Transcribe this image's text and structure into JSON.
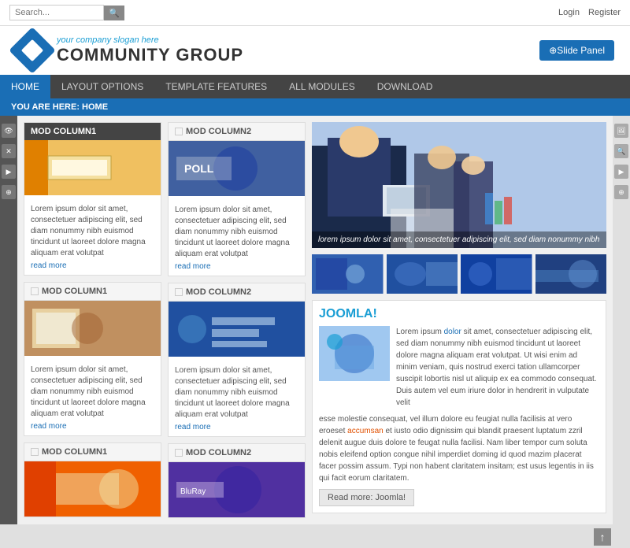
{
  "topBar": {
    "searchPlaceholder": "Search...",
    "searchBtnLabel": "🔍",
    "loginLabel": "Login",
    "registerLabel": "Register"
  },
  "header": {
    "slogan": "your company slogan here",
    "title": "COMMUNITY GROUP",
    "slidePanelLabel": "⊕Slide Panel"
  },
  "nav": {
    "items": [
      {
        "label": "HOME",
        "active": true
      },
      {
        "label": "LAYOUT OPTIONS",
        "active": false
      },
      {
        "label": "TEMPLATE FEATURES",
        "active": false
      },
      {
        "label": "ALL MODULES",
        "active": false
      },
      {
        "label": "DOWNLOAD",
        "active": false
      }
    ]
  },
  "breadcrumb": "YOU ARE HERE: HOME",
  "leftSidebar": {
    "icons": [
      "👁",
      "✕",
      "▶",
      "⊕"
    ]
  },
  "rightSidebar": {
    "icons": [
      "🖼",
      "🔍",
      "▶",
      "⊕"
    ]
  },
  "columns": {
    "col1": {
      "modules": [
        {
          "header": "MOD COLUMN1",
          "headerStyle": "dark",
          "text": "Lorem ipsum dolor sit amet, consectetuer adipiscing elit, sed diam nonummy nibh euismod tincidunt ut laoreet dolore magna aliquam erat volutpat",
          "readMore": "read more"
        },
        {
          "header": "MOD COLUMN1",
          "headerStyle": "light",
          "text": "Lorem ipsum dolor sit amet, consectetuer adipiscing elit, sed diam nonummy nibh euismod tincidunt ut laoreet dolore magna aliquam erat volutpat",
          "readMore": "read more"
        },
        {
          "header": "MOD COLUMN1",
          "headerStyle": "light",
          "text": "",
          "readMore": ""
        }
      ]
    },
    "col2": {
      "modules": [
        {
          "header": "MOD COLUMN2",
          "headerStyle": "light",
          "text": "Lorem ipsum dolor sit amet, consectetuer adipiscing elit, sed diam nonummy nibh euismod tincidunt ut laoreet dolore magna aliquam erat volutpat",
          "readMore": "read more"
        },
        {
          "header": "MOD COLUMN2",
          "headerStyle": "light",
          "text": "Lorem ipsum dolor sit amet, consectetuer adipiscing elit, sed diam nonummy nibh euismod tincidunt ut laoreet dolore magna aliquam erat volutpat",
          "readMore": "read more"
        },
        {
          "header": "MOD COLUMN2",
          "headerStyle": "light",
          "text": "",
          "readMore": ""
        }
      ]
    }
  },
  "rightCol": {
    "heroCaption": "lorem ipsum dolor sit amet, consectetuer adipiscing elit, sed diam nonummy nibh",
    "joomlaTitle": "JOOMLA!",
    "joomlaText": "Lorem ipsum dolor sit amet, consectetuer adipiscing elit, sed diam nonummy nibh euismod tincidunt ut laoreet dolore magna aliquam erat volutpat. Ut wisi enim ad minim veniam, quis nostrud exerci tation ullamcorper suscipit lobortis nisl ut aliquip ex ea commodo consequat. Duis autem vel eum iriure dolor in hendrerit in vulputate velit",
    "joomlaLongText": "esse molestie consequat, vel illum dolore eu feugiat nulla facilisis at vero eroeset accumsan et iusto odio dignissim qui blandit praesent luptatum zzril delenit augue duis dolore te feugat nulla facilisi. Nam liber tempor cum soluta nobis eleifend option congue nihil imperdiet doming id quod mazim placerat facer possim assum. Typi non habent claritatem insitam; est usus legentis in iis qui facit eorum claritatem.",
    "readMoreBtn": "Read more: Joomla!",
    "joomlaLink": "dolor"
  },
  "scrollTop": "↑"
}
